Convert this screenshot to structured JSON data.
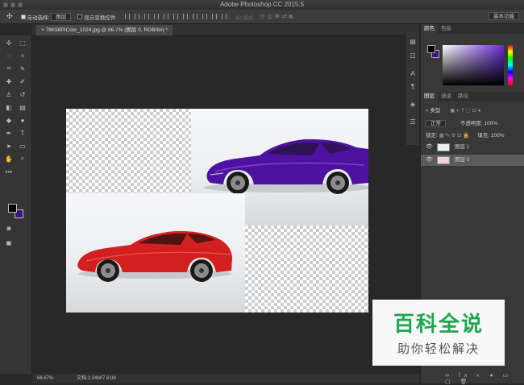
{
  "app": {
    "title": "Adobe Photoshop CC 2015.5"
  },
  "options_bar": {
    "auto_select_label": "自动选择:",
    "auto_select_value": "图层",
    "show_transform_label": "显示变换控件",
    "mode_3d": "3D 模式:",
    "workspace": "基本功能"
  },
  "document": {
    "tab_title": "78K58PICdvr_1024.jpg @ 66.7% (图层 0, RGB/8#) *"
  },
  "status": {
    "zoom": "66.67%",
    "doc_size": "文档:2.04M/7.61M"
  },
  "colors": {
    "foreground": "#000000",
    "background": "#3a137c",
    "accent_red": "#d21f1f",
    "accent_purple": "#4f12a0"
  },
  "color_panel": {
    "tabs": [
      "颜色",
      "色板"
    ]
  },
  "layers_panel": {
    "tabs": [
      "图层",
      "通道",
      "路径"
    ],
    "filter_kind": "类型",
    "blend_mode": "正常",
    "opacity_label": "不透明度:",
    "opacity_value": "100%",
    "lock_label": "锁定:",
    "fill_label": "填充:",
    "fill_value": "100%",
    "layers": [
      {
        "name": "图层 1",
        "selected": false
      },
      {
        "name": "图层 0",
        "selected": true
      }
    ]
  },
  "watermark": {
    "line1": "百科全说",
    "line2": "助你轻松解决"
  }
}
